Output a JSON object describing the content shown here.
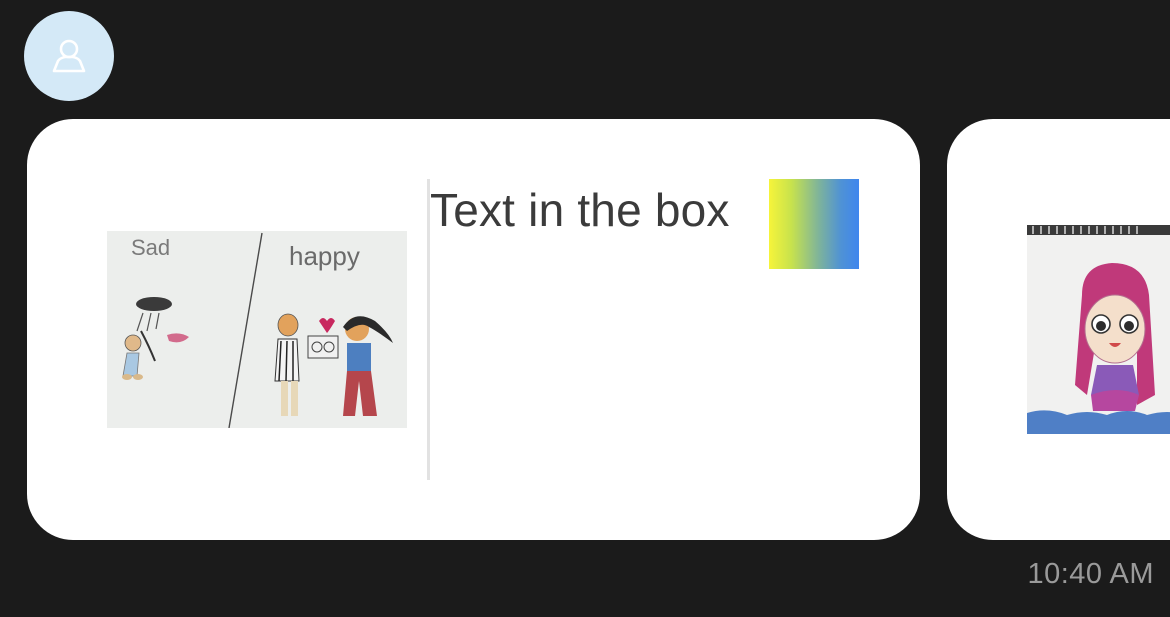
{
  "conversation": {
    "sender_avatar_icon": "person-outline-icon",
    "messages": [
      {
        "type": "card",
        "image_caption_words": [
          "Sad",
          "happy"
        ],
        "text": "Text in the box",
        "swatch_colors": [
          "#f6f43a",
          "#3f86ee"
        ]
      },
      {
        "type": "card-partial"
      }
    ],
    "timestamp": "10:40 AM"
  }
}
